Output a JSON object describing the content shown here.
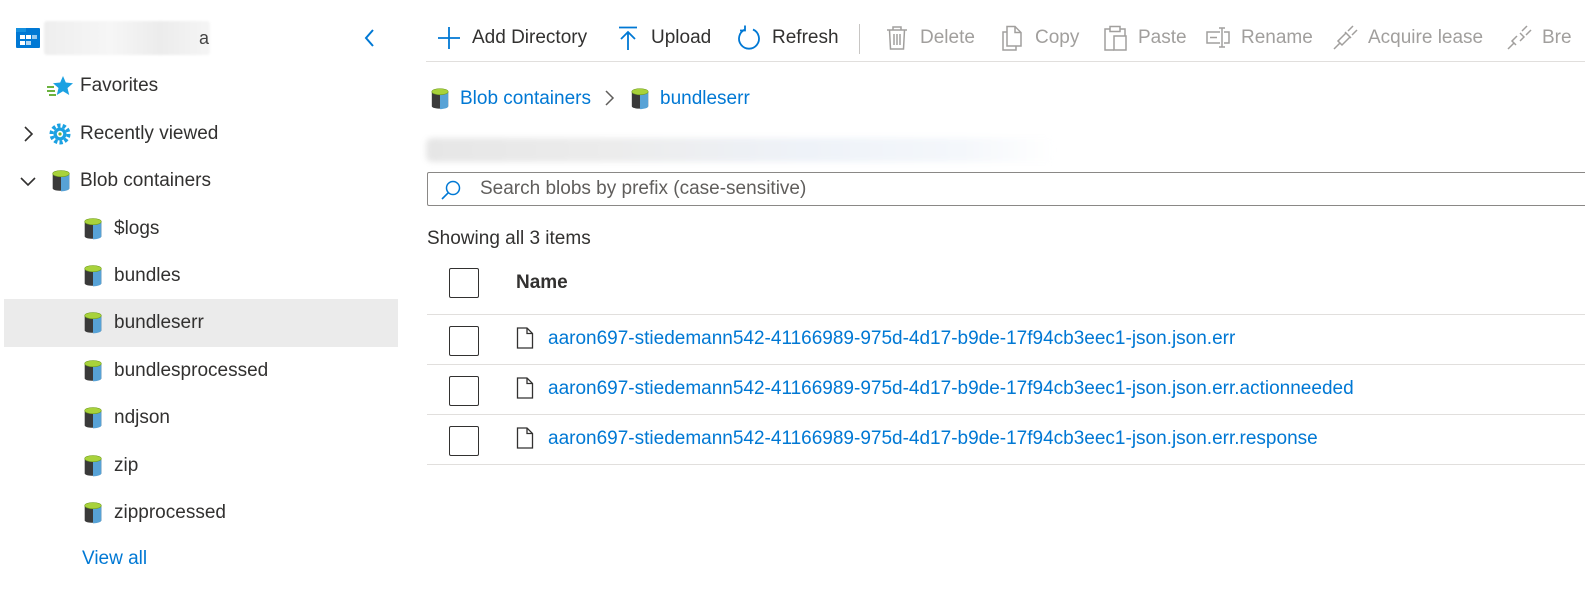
{
  "tree": {
    "account_suffix": "a",
    "collapse_label": "Collapse",
    "favorites": "Favorites",
    "recently_viewed": "Recently viewed",
    "blob_containers": "Blob containers",
    "containers": [
      "$logs",
      "bundles",
      "bundleserr",
      "bundlesprocessed",
      "ndjson",
      "zip",
      "zipprocessed"
    ],
    "selected_container": "bundleserr",
    "view_all": "View all"
  },
  "toolbar": {
    "add_directory": "Add Directory",
    "upload": "Upload",
    "refresh": "Refresh",
    "delete": "Delete",
    "copy": "Copy",
    "paste": "Paste",
    "rename": "Rename",
    "acquire_lease": "Acquire lease",
    "break_lease": "Bre"
  },
  "breadcrumb": [
    "Blob containers",
    "bundleserr"
  ],
  "search": {
    "placeholder": "Search blobs by prefix (case-sensitive)"
  },
  "status": "Showing all 3 items",
  "table": {
    "header": "Name",
    "rows": [
      "aaron697-stiedemann542-41166989-975d-4d17-b9de-17f94cb3eec1-json.json.err",
      "aaron697-stiedemann542-41166989-975d-4d17-b9de-17f94cb3eec1-json.json.err.actionneeded",
      "aaron697-stiedemann542-41166989-975d-4d17-b9de-17f94cb3eec1-json.json.err.response"
    ]
  },
  "colors": {
    "accent": "#0078d4",
    "selected_bg": "#ebebeb",
    "disabled": "#a19f9d"
  },
  "icons": {
    "account": "storage-account-icon",
    "favorites": "star-icon",
    "recent": "gear-icon",
    "container": "cylinder-icon",
    "file": "document-icon"
  }
}
